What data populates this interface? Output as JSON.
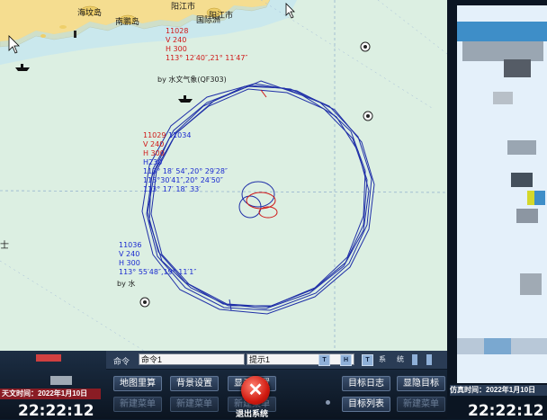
{
  "map": {
    "place_names": [
      "海坟岛",
      "南鹏岛",
      "阳江市",
      "阳江市",
      "国际洲"
    ],
    "by_label": "by 水文气象(QF303)",
    "by_label_2": "by 水",
    "target_11028": {
      "id": "11028",
      "v": "V 240",
      "h": "H 300",
      "pos": "113° 12′40″,21° 11′47″"
    },
    "target_11029": {
      "id": "11029",
      "id2": "11034",
      "v": "V 240",
      "h": "H 300",
      "extra": "H230",
      "pos1": "113° 18′ 54″,20° 29′28″",
      "pos2": "113°30′41″,20° 24′50″",
      "pos3": "113° 17′ 18″ 33′"
    },
    "target_11036": {
      "id": "11036",
      "v": "V 240",
      "h": "H 300",
      "pos": "113° 55′48″,19° 11′1″"
    },
    "left_char": "士"
  },
  "command_bar": {
    "command_label": "命令",
    "command_value": "命令1",
    "hint_value": "提示1",
    "btn_t": "T",
    "btn_h": "H",
    "btn_t2": "T",
    "sys_label": "系",
    "stat_label": "统"
  },
  "buttons": {
    "map_mileage": "地图里算",
    "background_settings": "背景设置",
    "display_settings": "显示设置",
    "target_log": "目标日志",
    "show_hide_targets": "显隐目标",
    "new_menu_1": "新建菜单",
    "new_menu_2": "新建菜单",
    "new_menu_3": "新建菜单",
    "target_list": "目标列表",
    "new_menu_4": "新建菜单",
    "exit_label": "退出系统"
  },
  "status": {
    "date_badge": "天文时间：2022年1月10日",
    "clock_left": "22:22:12",
    "sim_time_label": "仿真时间：2022年1月10日",
    "clock_right": "22:22:12"
  },
  "colors": {
    "map_bg": "#dcefe2",
    "track": "#2030a8",
    "red_label": "#d01818",
    "blue_label": "#1a2ad0"
  },
  "icons": [
    "cursor-arrow-icon",
    "ship-icon",
    "buoy-icon",
    "exit-x-icon"
  ]
}
